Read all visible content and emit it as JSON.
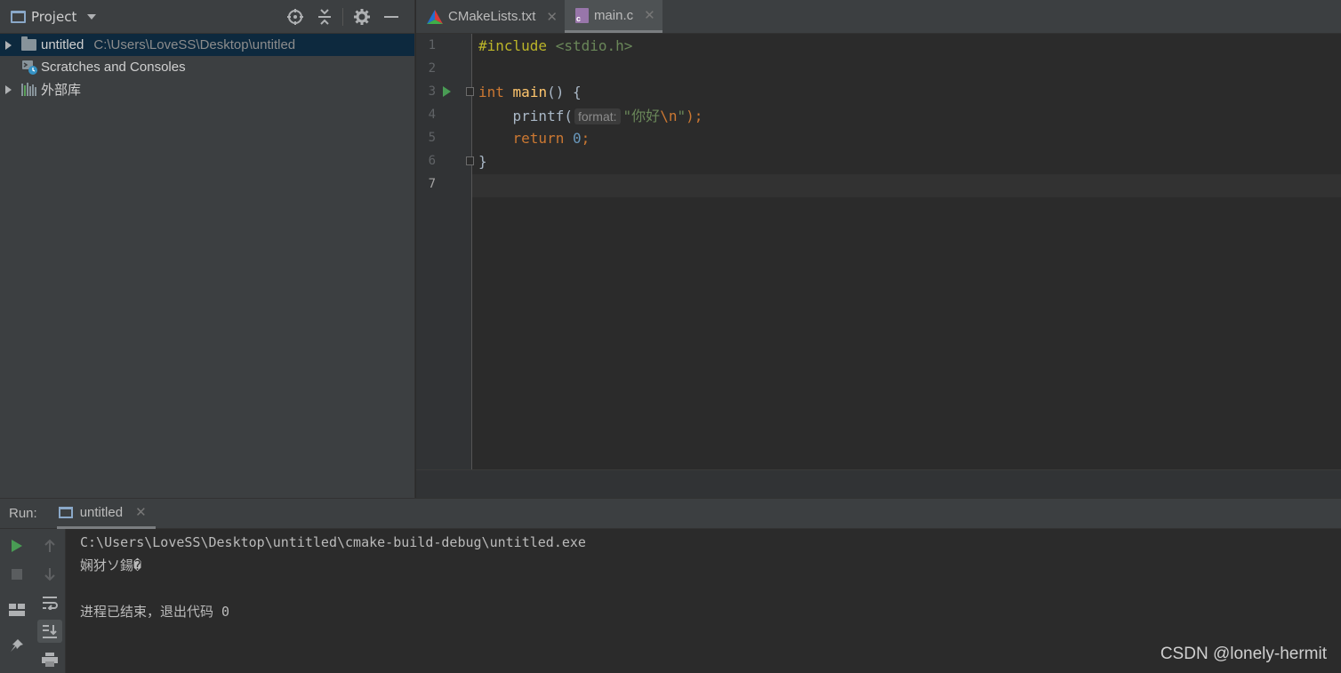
{
  "project_panel": {
    "title": "Project",
    "tree": [
      {
        "label": "untitled",
        "path": "C:\\Users\\LoveSS\\Desktop\\untitled",
        "icon": "folder-icon",
        "expandable": true,
        "selected": true
      },
      {
        "label": "Scratches and Consoles",
        "path": "",
        "icon": "scratches-icon",
        "expandable": false
      },
      {
        "label": "外部库",
        "path": "",
        "icon": "libraries-icon",
        "expandable": true
      }
    ]
  },
  "editor": {
    "tabs": [
      {
        "label": "CMakeLists.txt",
        "icon": "cmake-icon",
        "active": false
      },
      {
        "label": "main.c",
        "icon": "c-file-icon",
        "active": true
      }
    ],
    "line_numbers": [
      "1",
      "2",
      "3",
      "4",
      "5",
      "6",
      "7"
    ],
    "current_line": "7",
    "code": {
      "l1_directive": "#include",
      "l1_header": "<stdio.h>",
      "l3_type": "int",
      "l3_fn": "main",
      "l3_rest": "() {",
      "l4_call": "printf(",
      "l4_hint": "format:",
      "l4_str_open": "\"你好",
      "l4_escape": "\\n",
      "l4_str_close": "\"",
      "l4_end": ");",
      "l5_kw": "return",
      "l5_num": "0",
      "l5_end": ";",
      "l6": "}"
    }
  },
  "run_panel": {
    "label": "Run:",
    "tab_label": "untitled",
    "console_lines": [
      "C:\\Users\\LoveSS\\Desktop\\untitled\\cmake-build-debug\\untitled.exe",
      "娴犲ソ鍚�",
      "",
      "进程已结束，退出代码 0"
    ]
  },
  "watermark": "CSDN @lonely-hermit",
  "colors": {
    "keyword": "#cc7832",
    "function": "#ffc66d",
    "string": "#6a8759",
    "number": "#6897bb",
    "preprocessor": "#bbb529",
    "run_green": "#499c54"
  }
}
